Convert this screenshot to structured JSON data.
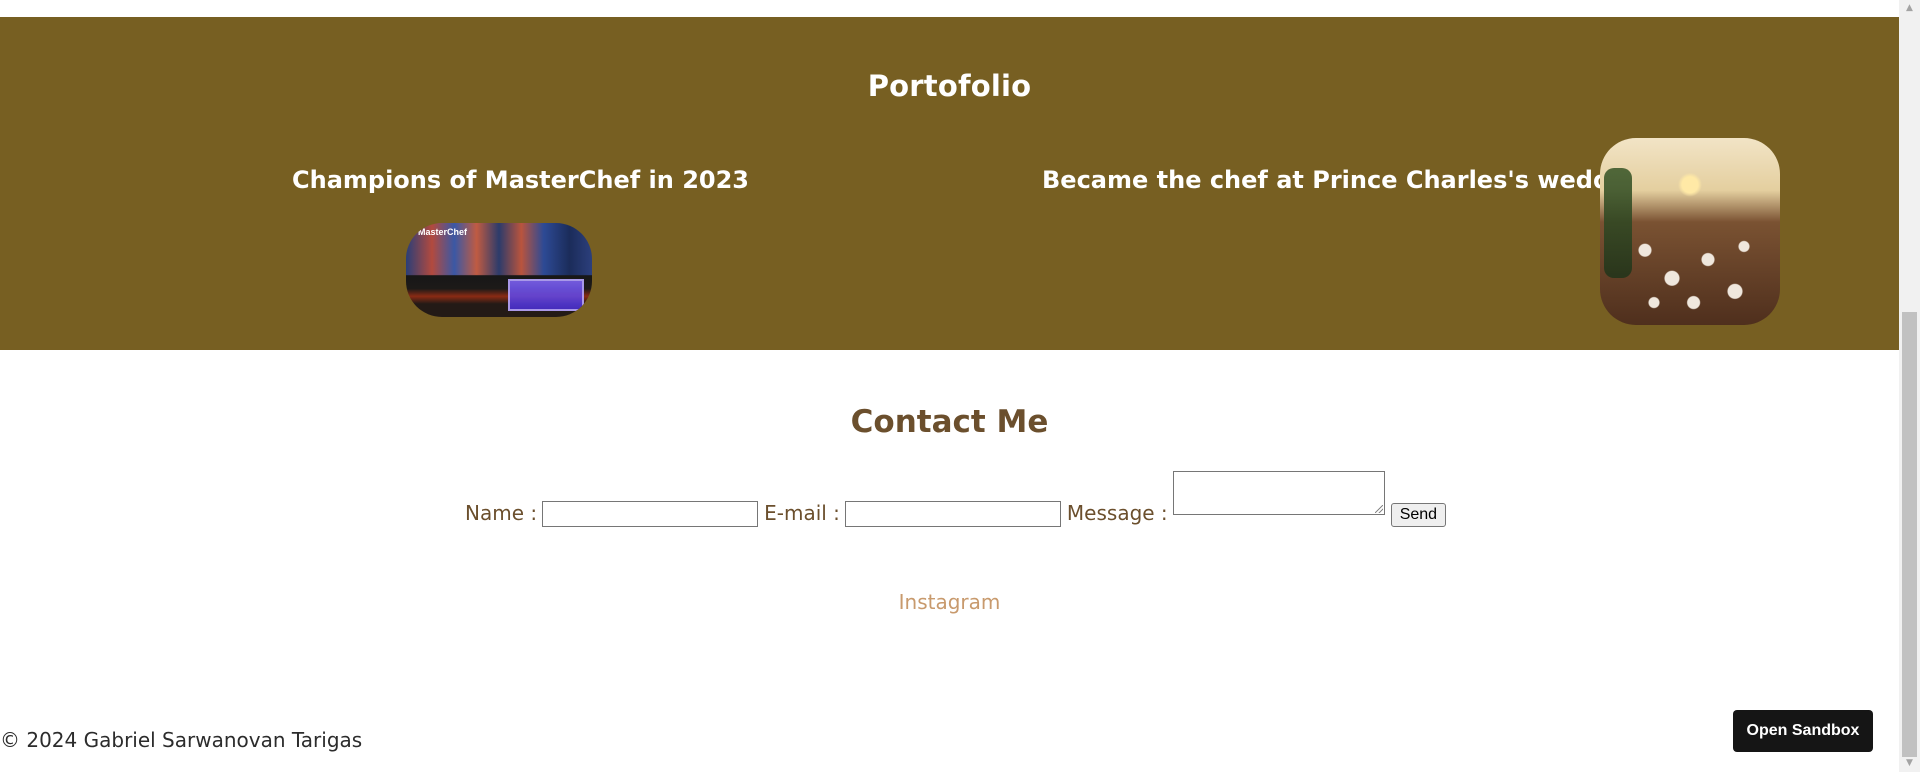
{
  "portfolio": {
    "title": "Portofolio",
    "items": [
      {
        "title": "Champions of MasterChef in 2023",
        "image_sign": "MasterChef"
      },
      {
        "title": "Became the chef at Prince Charles's wedding"
      }
    ]
  },
  "contact": {
    "title": "Contact Me",
    "name_label": "Name :",
    "email_label": "E-mail :",
    "message_label": "Message :",
    "send_label": "Send",
    "name_value": "",
    "email_value": "",
    "message_value": ""
  },
  "links": {
    "instagram": "Instagram"
  },
  "footer": {
    "copyright": "© 2024 Gabriel Sarwanovan Tarigas"
  },
  "sandbox": {
    "label": "Open Sandbox"
  },
  "colors": {
    "portfolio_bg": "#775f22",
    "heading_brown": "#6b4f2d",
    "link": "#c89a6d"
  }
}
